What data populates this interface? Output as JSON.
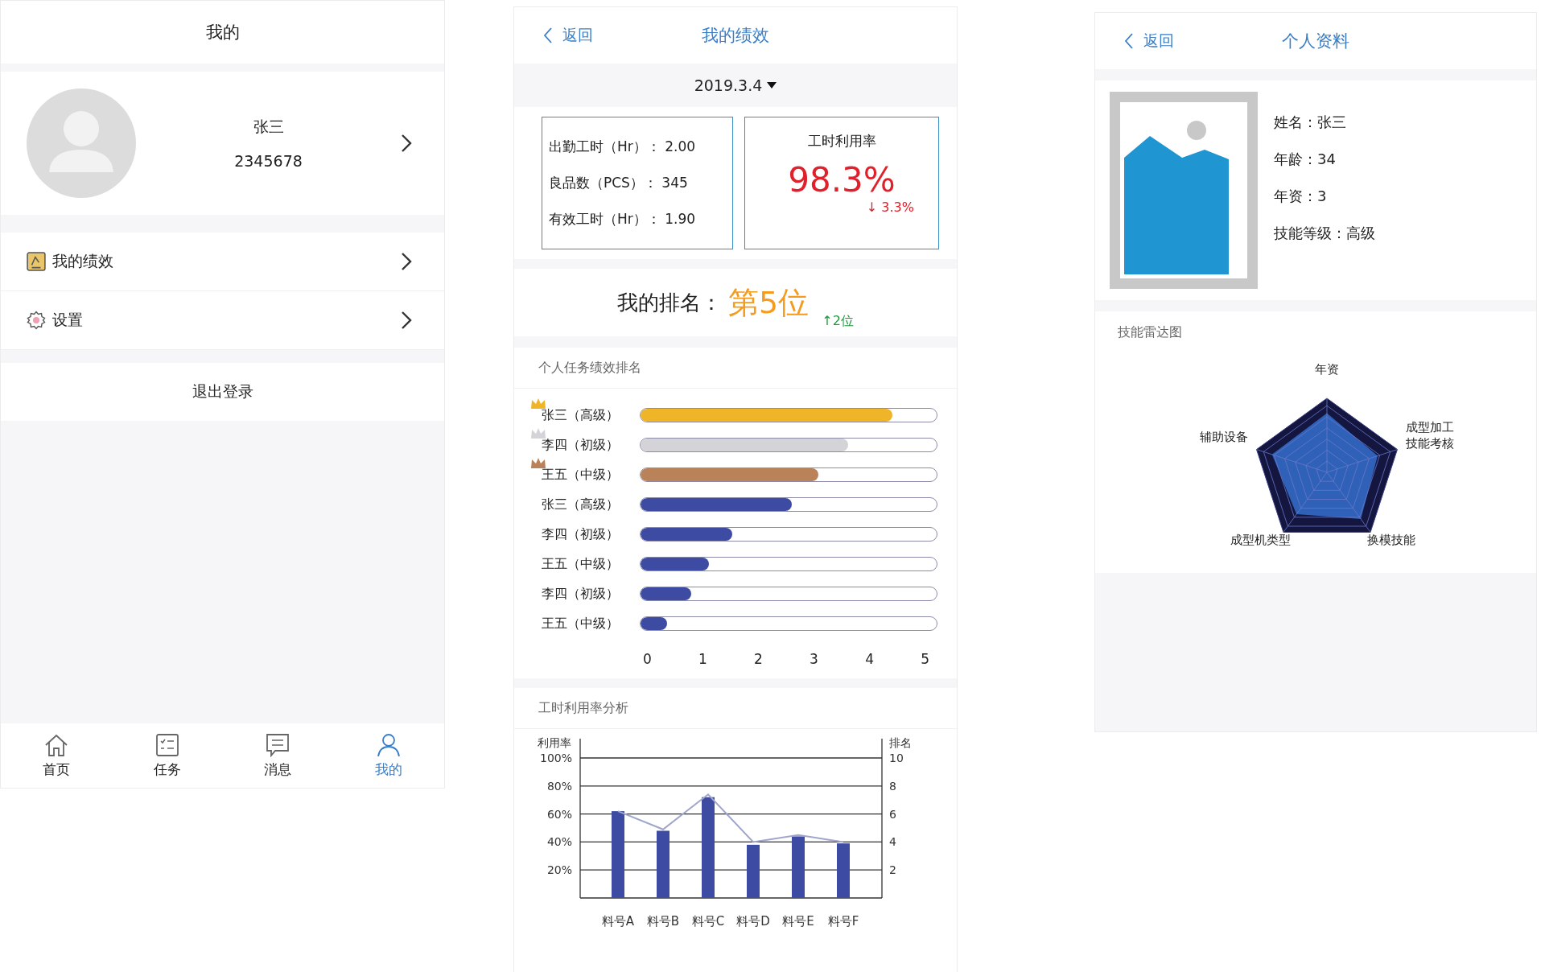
{
  "profile_screen": {
    "title": "我的",
    "user": {
      "name": "张三",
      "id": "2345678"
    },
    "menu": [
      {
        "label": "我的绩效",
        "kind": "performance"
      },
      {
        "label": "设置",
        "kind": "settings"
      }
    ],
    "logout": "退出登录",
    "tab_bar": [
      {
        "label": "首页",
        "kind": "home",
        "selected": false
      },
      {
        "label": "任务",
        "kind": "tasks",
        "selected": false
      },
      {
        "label": "消息",
        "kind": "messages",
        "selected": false
      },
      {
        "label": "我的",
        "kind": "me",
        "selected": true
      }
    ]
  },
  "performance_screen": {
    "back": "返回",
    "title": "我的绩效",
    "date": "2019.3.4",
    "stats": [
      {
        "label": "出勤工时（Hr）：",
        "value": "2.00"
      },
      {
        "label": "良品数（PCS）：",
        "value": "345"
      },
      {
        "label": "有效工时（Hr）：",
        "value": "1.90"
      }
    ],
    "utilization": {
      "title": "工时利用率",
      "value": "98.3%",
      "change": "↓ 3.3%"
    },
    "ranking": {
      "label": "我的排名：",
      "position": "第5位",
      "change": "↑2位"
    },
    "task_ranking": {
      "title": "个人任务绩效排名",
      "rows": [
        {
          "name": "张三（高级）",
          "level": 0.85,
          "color": "#f0b429",
          "crown": true
        },
        {
          "name": "李四（初级）",
          "level": 0.7,
          "color": "#d3d3d8",
          "crown": true
        },
        {
          "name": "王五（中级）",
          "level": 0.6,
          "color": "#b98258",
          "crown": true
        },
        {
          "name": "张三（高级）",
          "level": 0.51,
          "color": "#3e4ba3",
          "crown": false
        },
        {
          "name": "李四（初级）",
          "level": 0.31,
          "color": "#3e4ba3",
          "crown": false
        },
        {
          "name": "王五（中级）",
          "level": 0.23,
          "color": "#3e4ba3",
          "crown": false
        },
        {
          "name": "李四（初级）",
          "level": 0.17,
          "color": "#3e4ba3",
          "crown": false
        },
        {
          "name": "王五（中级）",
          "level": 0.09,
          "color": "#3e4ba3",
          "crown": false
        }
      ],
      "axis_ticks": [
        "0",
        "1",
        "2",
        "3",
        "4",
        "5"
      ]
    },
    "utilization_analysis": {
      "title": "工时利用率分析",
      "chart_data": {
        "type": "bar",
        "ylabel": "利用率",
        "categories": [
          "料号A",
          "料号B",
          "料号C",
          "料号D",
          "料号E",
          "料号F"
        ],
        "series": [
          {
            "type": "bar",
            "color": "#3e4ba3",
            "values": [
              62,
              48,
              72,
              38,
              44,
              39
            ]
          },
          {
            "type": "line",
            "color": "#a0a5cc",
            "values": [
              62,
              49,
              74,
              40,
              45,
              40
            ]
          }
        ],
        "ylim": [
          0,
          100
        ],
        "grid": true,
        "yticks": [
          {
            "value": 20,
            "label": "20%"
          },
          {
            "value": 40,
            "label": "40%"
          },
          {
            "value": 60,
            "label": "60%"
          },
          {
            "value": 80,
            "label": "80%"
          },
          {
            "value": 100,
            "label": "100%"
          }
        ]
      },
      "right_axis": {
        "label": "排名",
        "ticks": [
          "10",
          "8",
          "6",
          "4",
          "2"
        ]
      }
    }
  },
  "personal_info_screen": {
    "back": "返回",
    "title": "个人资料",
    "fields": [
      {
        "label": "姓名：",
        "value": "张三"
      },
      {
        "label": "年龄：",
        "value": "34"
      },
      {
        "label": "年资：",
        "value": "3"
      },
      {
        "label": "技能等级：",
        "value": "高级"
      }
    ],
    "radar": {
      "title": "技能雷达图",
      "axes": [
        "年资",
        "成型加工技能考核",
        "换模技能",
        "成型机类型",
        "辅助设备"
      ]
    }
  }
}
